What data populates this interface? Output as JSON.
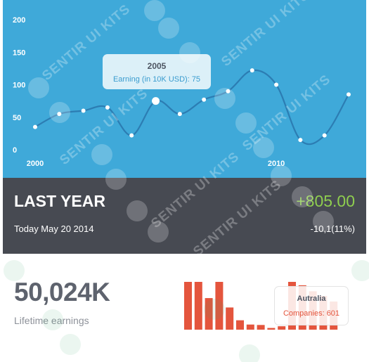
{
  "chart_data": [
    {
      "type": "line",
      "x": [
        2000,
        2001,
        2002,
        2003,
        2004,
        2005,
        2006,
        2007,
        2008,
        2009,
        2010,
        2011,
        2012,
        2013
      ],
      "values": [
        35,
        55,
        60,
        65,
        22,
        75,
        55,
        77,
        90,
        122,
        100,
        15,
        22,
        85
      ],
      "x_tick_labels": [
        "2000",
        "2010"
      ],
      "y_ticks": [
        0,
        50,
        100,
        150,
        200
      ],
      "ylim": [
        0,
        200
      ],
      "tooltip": {
        "title": "2005",
        "series_label": "Earning (in 10K USD)",
        "value": 75,
        "text": "Earning (in 10K USD): 75"
      },
      "grid": false,
      "colors": {
        "line": "#2c7db3",
        "point": "#ffffff",
        "background": "#3fa9d9"
      }
    },
    {
      "type": "bar",
      "values": [
        560,
        560,
        370,
        560,
        260,
        110,
        60,
        55,
        20,
        40,
        560,
        520,
        450,
        395,
        330
      ],
      "tooltip": {
        "title": "Autralia",
        "series_label": "Companies",
        "value": 601,
        "text": "Companies: 601"
      },
      "colors": {
        "bar": "#e4553d"
      }
    }
  ],
  "summary": {
    "heading": "LAST YEAR",
    "amount": "+805.00",
    "date": "Today May 20 2014",
    "change": "-10,1(11%)",
    "amount_color": "#8fce4f"
  },
  "stats": {
    "value": "50,024K",
    "label": "Lifetime earnings"
  },
  "watermark": {
    "text": "SENTIR UI KITS"
  },
  "colors": {
    "panel_blue": "#3fa9d9",
    "band_dark": "#474a52",
    "bar_red": "#e4553d"
  }
}
